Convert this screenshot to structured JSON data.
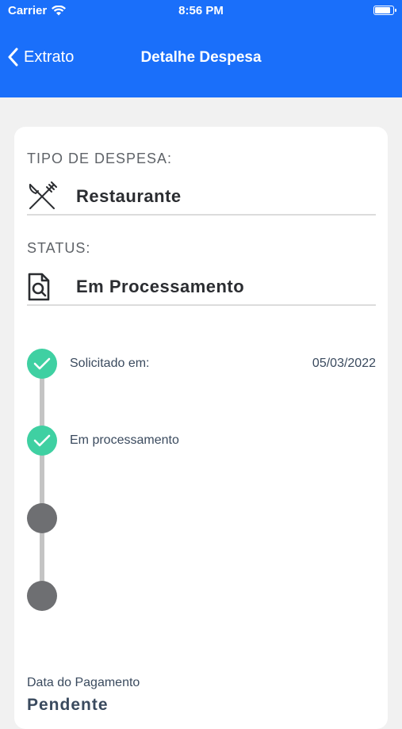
{
  "status_bar": {
    "carrier": "Carrier",
    "time": "8:56 PM",
    "battery_level": 0.9
  },
  "nav": {
    "back_label": "Extrato",
    "title": "Detalhe Despesa"
  },
  "expense_type": {
    "label": "TIPO DE DESPESA:",
    "value": "Restaurante",
    "icon": "fork-knife-icon"
  },
  "status": {
    "label": "STATUS:",
    "value": "Em Processamento",
    "icon": "document-search-icon"
  },
  "timeline": [
    {
      "label": "Solicitado em:",
      "date": "05/03/2022",
      "state": "done"
    },
    {
      "label": "Em processamento",
      "date": "",
      "state": "done"
    },
    {
      "label": "",
      "date": "",
      "state": "pending"
    },
    {
      "label": "",
      "date": "",
      "state": "pending"
    }
  ],
  "payment": {
    "label": "Data do Pagamento",
    "value": "Pendente"
  },
  "colors": {
    "header": "#1a6ffa",
    "done": "#3fd0a2",
    "pending": "#6e6f72",
    "line": "#c4c4c4"
  }
}
